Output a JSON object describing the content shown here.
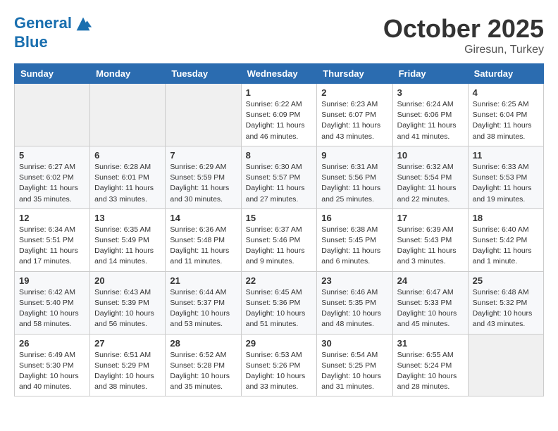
{
  "header": {
    "logo_line1": "General",
    "logo_line2": "Blue",
    "month": "October 2025",
    "location": "Giresun, Turkey"
  },
  "weekdays": [
    "Sunday",
    "Monday",
    "Tuesday",
    "Wednesday",
    "Thursday",
    "Friday",
    "Saturday"
  ],
  "weeks": [
    [
      {
        "day": "",
        "content": ""
      },
      {
        "day": "",
        "content": ""
      },
      {
        "day": "",
        "content": ""
      },
      {
        "day": "1",
        "content": "Sunrise: 6:22 AM\nSunset: 6:09 PM\nDaylight: 11 hours\nand 46 minutes."
      },
      {
        "day": "2",
        "content": "Sunrise: 6:23 AM\nSunset: 6:07 PM\nDaylight: 11 hours\nand 43 minutes."
      },
      {
        "day": "3",
        "content": "Sunrise: 6:24 AM\nSunset: 6:06 PM\nDaylight: 11 hours\nand 41 minutes."
      },
      {
        "day": "4",
        "content": "Sunrise: 6:25 AM\nSunset: 6:04 PM\nDaylight: 11 hours\nand 38 minutes."
      }
    ],
    [
      {
        "day": "5",
        "content": "Sunrise: 6:27 AM\nSunset: 6:02 PM\nDaylight: 11 hours\nand 35 minutes."
      },
      {
        "day": "6",
        "content": "Sunrise: 6:28 AM\nSunset: 6:01 PM\nDaylight: 11 hours\nand 33 minutes."
      },
      {
        "day": "7",
        "content": "Sunrise: 6:29 AM\nSunset: 5:59 PM\nDaylight: 11 hours\nand 30 minutes."
      },
      {
        "day": "8",
        "content": "Sunrise: 6:30 AM\nSunset: 5:57 PM\nDaylight: 11 hours\nand 27 minutes."
      },
      {
        "day": "9",
        "content": "Sunrise: 6:31 AM\nSunset: 5:56 PM\nDaylight: 11 hours\nand 25 minutes."
      },
      {
        "day": "10",
        "content": "Sunrise: 6:32 AM\nSunset: 5:54 PM\nDaylight: 11 hours\nand 22 minutes."
      },
      {
        "day": "11",
        "content": "Sunrise: 6:33 AM\nSunset: 5:53 PM\nDaylight: 11 hours\nand 19 minutes."
      }
    ],
    [
      {
        "day": "12",
        "content": "Sunrise: 6:34 AM\nSunset: 5:51 PM\nDaylight: 11 hours\nand 17 minutes."
      },
      {
        "day": "13",
        "content": "Sunrise: 6:35 AM\nSunset: 5:49 PM\nDaylight: 11 hours\nand 14 minutes."
      },
      {
        "day": "14",
        "content": "Sunrise: 6:36 AM\nSunset: 5:48 PM\nDaylight: 11 hours\nand 11 minutes."
      },
      {
        "day": "15",
        "content": "Sunrise: 6:37 AM\nSunset: 5:46 PM\nDaylight: 11 hours\nand 9 minutes."
      },
      {
        "day": "16",
        "content": "Sunrise: 6:38 AM\nSunset: 5:45 PM\nDaylight: 11 hours\nand 6 minutes."
      },
      {
        "day": "17",
        "content": "Sunrise: 6:39 AM\nSunset: 5:43 PM\nDaylight: 11 hours\nand 3 minutes."
      },
      {
        "day": "18",
        "content": "Sunrise: 6:40 AM\nSunset: 5:42 PM\nDaylight: 11 hours\nand 1 minute."
      }
    ],
    [
      {
        "day": "19",
        "content": "Sunrise: 6:42 AM\nSunset: 5:40 PM\nDaylight: 10 hours\nand 58 minutes."
      },
      {
        "day": "20",
        "content": "Sunrise: 6:43 AM\nSunset: 5:39 PM\nDaylight: 10 hours\nand 56 minutes."
      },
      {
        "day": "21",
        "content": "Sunrise: 6:44 AM\nSunset: 5:37 PM\nDaylight: 10 hours\nand 53 minutes."
      },
      {
        "day": "22",
        "content": "Sunrise: 6:45 AM\nSunset: 5:36 PM\nDaylight: 10 hours\nand 51 minutes."
      },
      {
        "day": "23",
        "content": "Sunrise: 6:46 AM\nSunset: 5:35 PM\nDaylight: 10 hours\nand 48 minutes."
      },
      {
        "day": "24",
        "content": "Sunrise: 6:47 AM\nSunset: 5:33 PM\nDaylight: 10 hours\nand 45 minutes."
      },
      {
        "day": "25",
        "content": "Sunrise: 6:48 AM\nSunset: 5:32 PM\nDaylight: 10 hours\nand 43 minutes."
      }
    ],
    [
      {
        "day": "26",
        "content": "Sunrise: 6:49 AM\nSunset: 5:30 PM\nDaylight: 10 hours\nand 40 minutes."
      },
      {
        "day": "27",
        "content": "Sunrise: 6:51 AM\nSunset: 5:29 PM\nDaylight: 10 hours\nand 38 minutes."
      },
      {
        "day": "28",
        "content": "Sunrise: 6:52 AM\nSunset: 5:28 PM\nDaylight: 10 hours\nand 35 minutes."
      },
      {
        "day": "29",
        "content": "Sunrise: 6:53 AM\nSunset: 5:26 PM\nDaylight: 10 hours\nand 33 minutes."
      },
      {
        "day": "30",
        "content": "Sunrise: 6:54 AM\nSunset: 5:25 PM\nDaylight: 10 hours\nand 31 minutes."
      },
      {
        "day": "31",
        "content": "Sunrise: 6:55 AM\nSunset: 5:24 PM\nDaylight: 10 hours\nand 28 minutes."
      },
      {
        "day": "",
        "content": ""
      }
    ]
  ]
}
